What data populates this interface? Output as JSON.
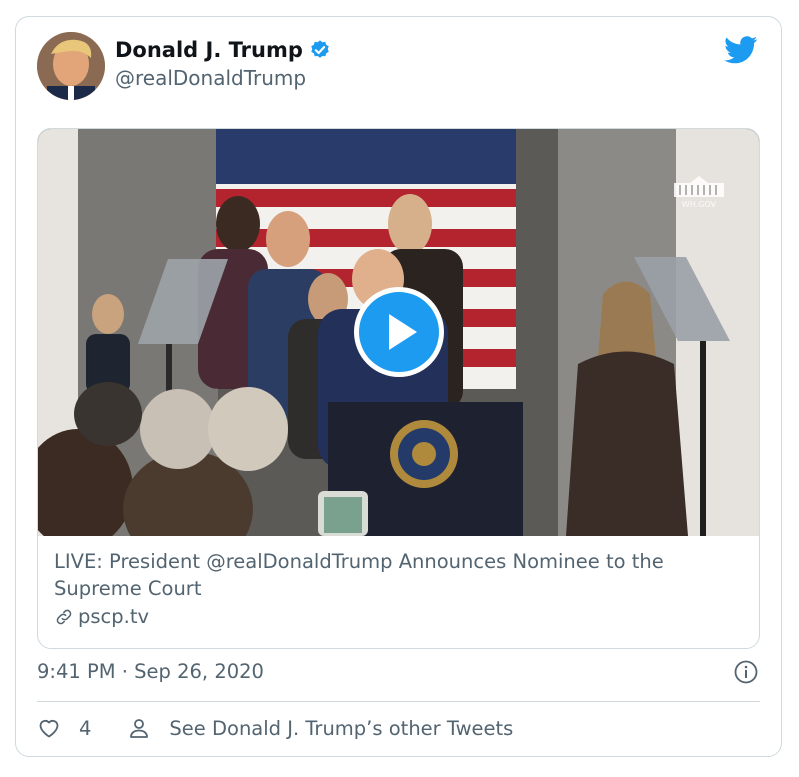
{
  "tweet": {
    "display_name": "Donald J. Trump",
    "handle": "@realDonaldTrump",
    "timestamp": "9:41 PM · Sep 26, 2020",
    "like_count": "4",
    "other_tweets_label": "See Donald J. Trump’s other Tweets"
  },
  "link_card": {
    "title": "LIVE: President @realDonaldTrump Announces Nominee to the Supreme Court",
    "domain": "pscp.tv",
    "watermark": "WH.GOV"
  },
  "icons": {
    "verified": "verified-badge-icon",
    "brand": "twitter-bird-icon",
    "play": "play-icon",
    "link": "link-icon",
    "info": "info-icon",
    "like": "heart-icon",
    "profile": "person-icon"
  },
  "colors": {
    "accent": "#1d9bf0",
    "text": "#0f1419",
    "secondary": "#536471",
    "border": "#cfd9de"
  }
}
